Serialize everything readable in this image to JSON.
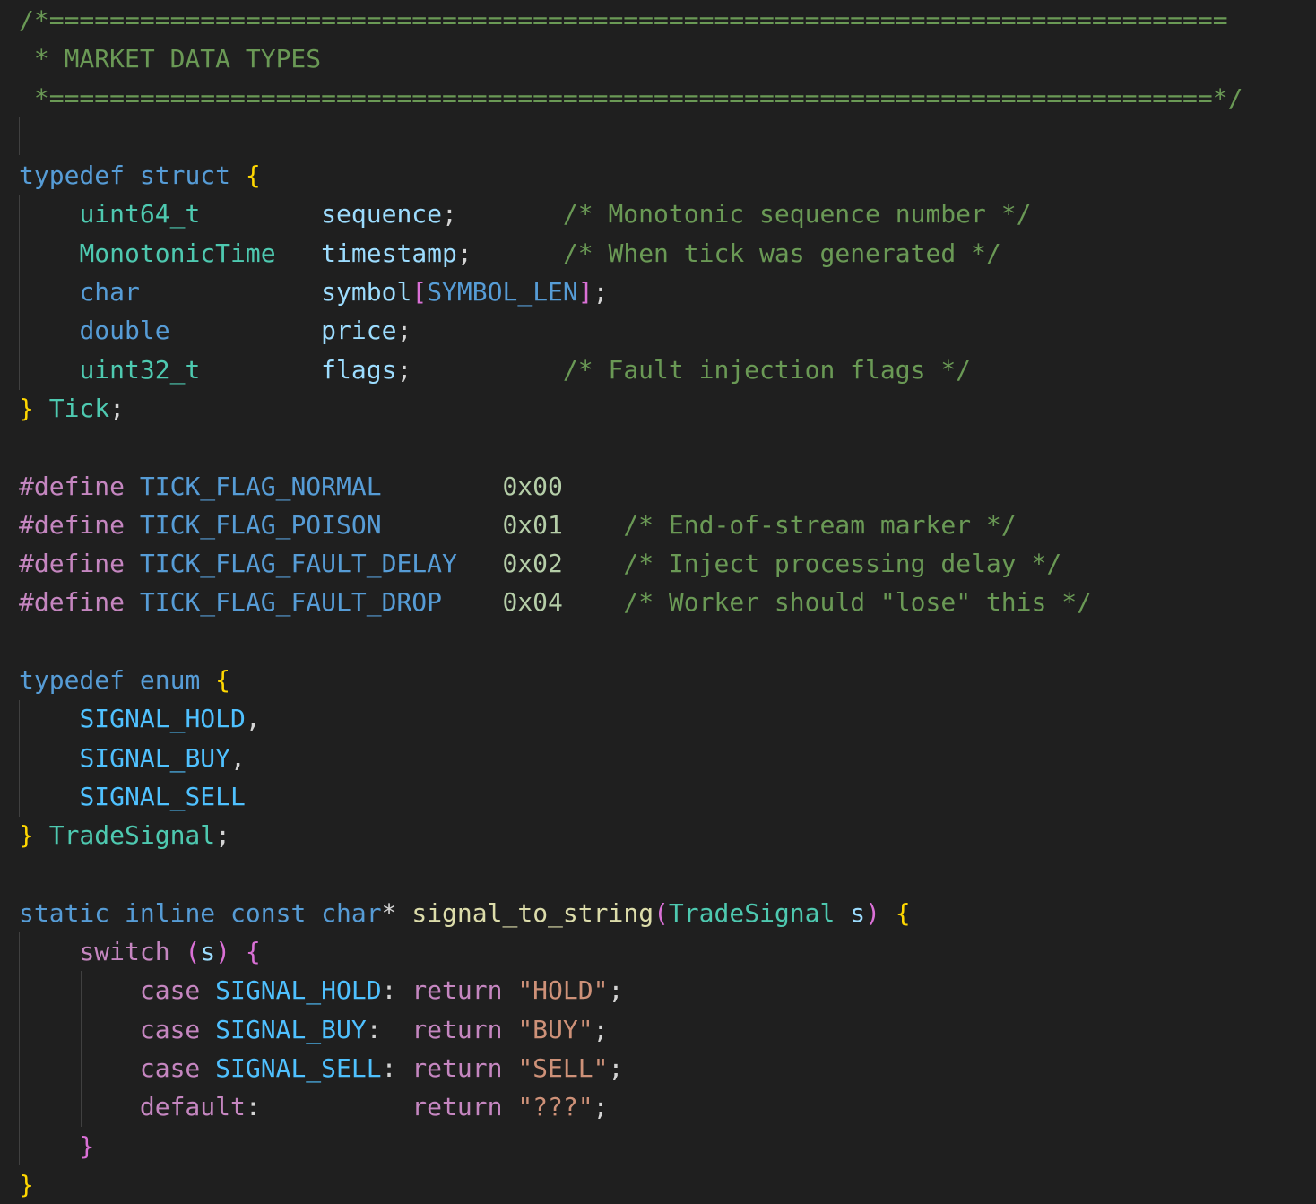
{
  "editor": {
    "language": "c",
    "theme_colors": {
      "background": "#1f1f1f",
      "comment": "#6a9955",
      "keyword": "#569cd6",
      "control_keyword": "#c586c0",
      "type": "#4ec9b0",
      "variable": "#9cdcfe",
      "constant": "#4fc1ff",
      "function": "#dcdcaa",
      "string": "#ce9178",
      "number": "#b5cea8",
      "punctuation": "#d4d4d4",
      "bracket_level_1": "#ffd700",
      "bracket_level_2": "#da70d6",
      "bracket_level_3": "#179fff"
    },
    "lines": [
      {
        "tokens": [
          {
            "t": "cm",
            "v": "/*=============================================================================="
          }
        ]
      },
      {
        "tokens": [
          {
            "t": "cm",
            "v": " * MARKET DATA TYPES"
          }
        ]
      },
      {
        "tokens": [
          {
            "t": "cm",
            "v": " *=============================================================================*/"
          }
        ]
      },
      {
        "tokens": []
      },
      {
        "tokens": [
          {
            "t": "kw",
            "v": "typedef"
          },
          {
            "t": "p",
            "v": " "
          },
          {
            "t": "kw",
            "v": "struct"
          },
          {
            "t": "p",
            "v": " "
          },
          {
            "t": "b1",
            "v": "{"
          }
        ]
      },
      {
        "tokens": [
          {
            "t": "p",
            "v": "    "
          },
          {
            "t": "ty",
            "v": "uint64_t"
          },
          {
            "t": "p",
            "v": "        "
          },
          {
            "t": "id",
            "v": "sequence"
          },
          {
            "t": "p",
            "v": ";       "
          },
          {
            "t": "cm",
            "v": "/* Monotonic sequence number */"
          }
        ]
      },
      {
        "tokens": [
          {
            "t": "p",
            "v": "    "
          },
          {
            "t": "ty",
            "v": "MonotonicTime"
          },
          {
            "t": "p",
            "v": "   "
          },
          {
            "t": "id",
            "v": "timestamp"
          },
          {
            "t": "p",
            "v": ";      "
          },
          {
            "t": "cm",
            "v": "/* When tick was generated */"
          }
        ]
      },
      {
        "tokens": [
          {
            "t": "p",
            "v": "    "
          },
          {
            "t": "kw",
            "v": "char"
          },
          {
            "t": "p",
            "v": "            "
          },
          {
            "t": "id",
            "v": "symbol"
          },
          {
            "t": "b2",
            "v": "["
          },
          {
            "t": "kw",
            "v": "SYMBOL_LEN"
          },
          {
            "t": "b2",
            "v": "]"
          },
          {
            "t": "p",
            "v": ";"
          }
        ]
      },
      {
        "tokens": [
          {
            "t": "p",
            "v": "    "
          },
          {
            "t": "kw",
            "v": "double"
          },
          {
            "t": "p",
            "v": "          "
          },
          {
            "t": "id",
            "v": "price"
          },
          {
            "t": "p",
            "v": ";"
          }
        ]
      },
      {
        "tokens": [
          {
            "t": "p",
            "v": "    "
          },
          {
            "t": "ty",
            "v": "uint32_t"
          },
          {
            "t": "p",
            "v": "        "
          },
          {
            "t": "id",
            "v": "flags"
          },
          {
            "t": "p",
            "v": ";          "
          },
          {
            "t": "cm",
            "v": "/* Fault injection flags */"
          }
        ]
      },
      {
        "tokens": [
          {
            "t": "b1",
            "v": "}"
          },
          {
            "t": "p",
            "v": " "
          },
          {
            "t": "ty",
            "v": "Tick"
          },
          {
            "t": "p",
            "v": ";"
          }
        ]
      },
      {
        "tokens": []
      },
      {
        "tokens": [
          {
            "t": "ctl",
            "v": "#define"
          },
          {
            "t": "p",
            "v": " "
          },
          {
            "t": "kw",
            "v": "TICK_FLAG_NORMAL"
          },
          {
            "t": "p",
            "v": "        "
          },
          {
            "t": "num",
            "v": "0x00"
          }
        ]
      },
      {
        "tokens": [
          {
            "t": "ctl",
            "v": "#define"
          },
          {
            "t": "p",
            "v": " "
          },
          {
            "t": "kw",
            "v": "TICK_FLAG_POISON"
          },
          {
            "t": "p",
            "v": "        "
          },
          {
            "t": "num",
            "v": "0x01"
          },
          {
            "t": "p",
            "v": "    "
          },
          {
            "t": "cm",
            "v": "/* End-of-stream marker */"
          }
        ]
      },
      {
        "tokens": [
          {
            "t": "ctl",
            "v": "#define"
          },
          {
            "t": "p",
            "v": " "
          },
          {
            "t": "kw",
            "v": "TICK_FLAG_FAULT_DELAY"
          },
          {
            "t": "p",
            "v": "   "
          },
          {
            "t": "num",
            "v": "0x02"
          },
          {
            "t": "p",
            "v": "    "
          },
          {
            "t": "cm",
            "v": "/* Inject processing delay */"
          }
        ]
      },
      {
        "tokens": [
          {
            "t": "ctl",
            "v": "#define"
          },
          {
            "t": "p",
            "v": " "
          },
          {
            "t": "kw",
            "v": "TICK_FLAG_FAULT_DROP"
          },
          {
            "t": "p",
            "v": "    "
          },
          {
            "t": "num",
            "v": "0x04"
          },
          {
            "t": "p",
            "v": "    "
          },
          {
            "t": "cm",
            "v": "/* Worker should \"lose\" this */"
          }
        ]
      },
      {
        "tokens": []
      },
      {
        "tokens": [
          {
            "t": "kw",
            "v": "typedef"
          },
          {
            "t": "p",
            "v": " "
          },
          {
            "t": "kw",
            "v": "enum"
          },
          {
            "t": "p",
            "v": " "
          },
          {
            "t": "b1",
            "v": "{"
          }
        ]
      },
      {
        "tokens": [
          {
            "t": "p",
            "v": "    "
          },
          {
            "t": "const",
            "v": "SIGNAL_HOLD"
          },
          {
            "t": "p",
            "v": ","
          }
        ]
      },
      {
        "tokens": [
          {
            "t": "p",
            "v": "    "
          },
          {
            "t": "const",
            "v": "SIGNAL_BUY"
          },
          {
            "t": "p",
            "v": ","
          }
        ]
      },
      {
        "tokens": [
          {
            "t": "p",
            "v": "    "
          },
          {
            "t": "const",
            "v": "SIGNAL_SELL"
          }
        ]
      },
      {
        "tokens": [
          {
            "t": "b1",
            "v": "}"
          },
          {
            "t": "p",
            "v": " "
          },
          {
            "t": "ty",
            "v": "TradeSignal"
          },
          {
            "t": "p",
            "v": ";"
          }
        ]
      },
      {
        "tokens": []
      },
      {
        "tokens": [
          {
            "t": "kw",
            "v": "static"
          },
          {
            "t": "p",
            "v": " "
          },
          {
            "t": "kw",
            "v": "inline"
          },
          {
            "t": "p",
            "v": " "
          },
          {
            "t": "kw",
            "v": "const"
          },
          {
            "t": "p",
            "v": " "
          },
          {
            "t": "kw",
            "v": "char"
          },
          {
            "t": "p",
            "v": "* "
          },
          {
            "t": "fn",
            "v": "signal_to_string"
          },
          {
            "t": "b2",
            "v": "("
          },
          {
            "t": "ty",
            "v": "TradeSignal"
          },
          {
            "t": "p",
            "v": " "
          },
          {
            "t": "id",
            "v": "s"
          },
          {
            "t": "b2",
            "v": ")"
          },
          {
            "t": "p",
            "v": " "
          },
          {
            "t": "b1",
            "v": "{"
          }
        ]
      },
      {
        "tokens": [
          {
            "t": "p",
            "v": "    "
          },
          {
            "t": "ctl",
            "v": "switch"
          },
          {
            "t": "p",
            "v": " "
          },
          {
            "t": "b2",
            "v": "("
          },
          {
            "t": "id",
            "v": "s"
          },
          {
            "t": "b2",
            "v": ")"
          },
          {
            "t": "p",
            "v": " "
          },
          {
            "t": "b2",
            "v": "{"
          }
        ]
      },
      {
        "tokens": [
          {
            "t": "p",
            "v": "        "
          },
          {
            "t": "ctl",
            "v": "case"
          },
          {
            "t": "p",
            "v": " "
          },
          {
            "t": "const",
            "v": "SIGNAL_HOLD"
          },
          {
            "t": "p",
            "v": ": "
          },
          {
            "t": "ctl",
            "v": "return"
          },
          {
            "t": "p",
            "v": " "
          },
          {
            "t": "str",
            "v": "\"HOLD\""
          },
          {
            "t": "p",
            "v": ";"
          }
        ]
      },
      {
        "tokens": [
          {
            "t": "p",
            "v": "        "
          },
          {
            "t": "ctl",
            "v": "case"
          },
          {
            "t": "p",
            "v": " "
          },
          {
            "t": "const",
            "v": "SIGNAL_BUY"
          },
          {
            "t": "p",
            "v": ":  "
          },
          {
            "t": "ctl",
            "v": "return"
          },
          {
            "t": "p",
            "v": " "
          },
          {
            "t": "str",
            "v": "\"BUY\""
          },
          {
            "t": "p",
            "v": ";"
          }
        ]
      },
      {
        "tokens": [
          {
            "t": "p",
            "v": "        "
          },
          {
            "t": "ctl",
            "v": "case"
          },
          {
            "t": "p",
            "v": " "
          },
          {
            "t": "const",
            "v": "SIGNAL_SELL"
          },
          {
            "t": "p",
            "v": ": "
          },
          {
            "t": "ctl",
            "v": "return"
          },
          {
            "t": "p",
            "v": " "
          },
          {
            "t": "str",
            "v": "\"SELL\""
          },
          {
            "t": "p",
            "v": ";"
          }
        ]
      },
      {
        "tokens": [
          {
            "t": "p",
            "v": "        "
          },
          {
            "t": "ctl",
            "v": "default"
          },
          {
            "t": "p",
            "v": ":          "
          },
          {
            "t": "ctl",
            "v": "return"
          },
          {
            "t": "p",
            "v": " "
          },
          {
            "t": "str",
            "v": "\"???\""
          },
          {
            "t": "p",
            "v": ";"
          }
        ]
      },
      {
        "tokens": [
          {
            "t": "p",
            "v": "    "
          },
          {
            "t": "b2",
            "v": "}"
          }
        ]
      },
      {
        "tokens": [
          {
            "t": "b1",
            "v": "}"
          }
        ]
      }
    ]
  }
}
